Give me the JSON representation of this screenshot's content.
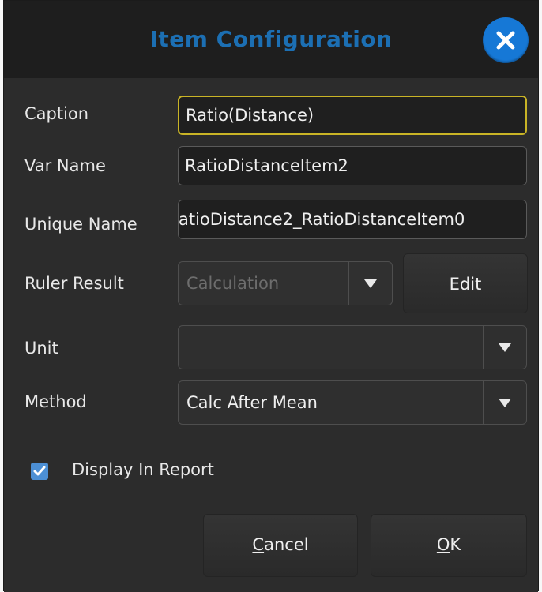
{
  "dialog": {
    "title": "Item Configuration",
    "close_icon": "close-icon"
  },
  "form": {
    "caption": {
      "label": "Caption",
      "value": "Ratio(Distance)"
    },
    "var_name": {
      "label": "Var Name",
      "value": "RatioDistanceItem2"
    },
    "unique_name": {
      "label": "Unique Name",
      "value": "atioDistance2_RatioDistanceItem0"
    },
    "ruler_result": {
      "label": "Ruler Result",
      "value": "Calculation",
      "edit_label": "Edit"
    },
    "unit": {
      "label": "Unit",
      "value": ""
    },
    "method": {
      "label": "Method",
      "value": "Calc After Mean"
    },
    "display_in_report": {
      "label": "Display In Report",
      "checked": true
    }
  },
  "buttons": {
    "cancel_mnemonic": "C",
    "cancel_rest": "ancel",
    "ok_mnemonic": "O",
    "ok_rest": "K"
  },
  "colors": {
    "title": "#1c6fb3",
    "close_button": "#1678d6",
    "focus_border": "#c9b426",
    "checkbox": "#4c8fd4"
  }
}
